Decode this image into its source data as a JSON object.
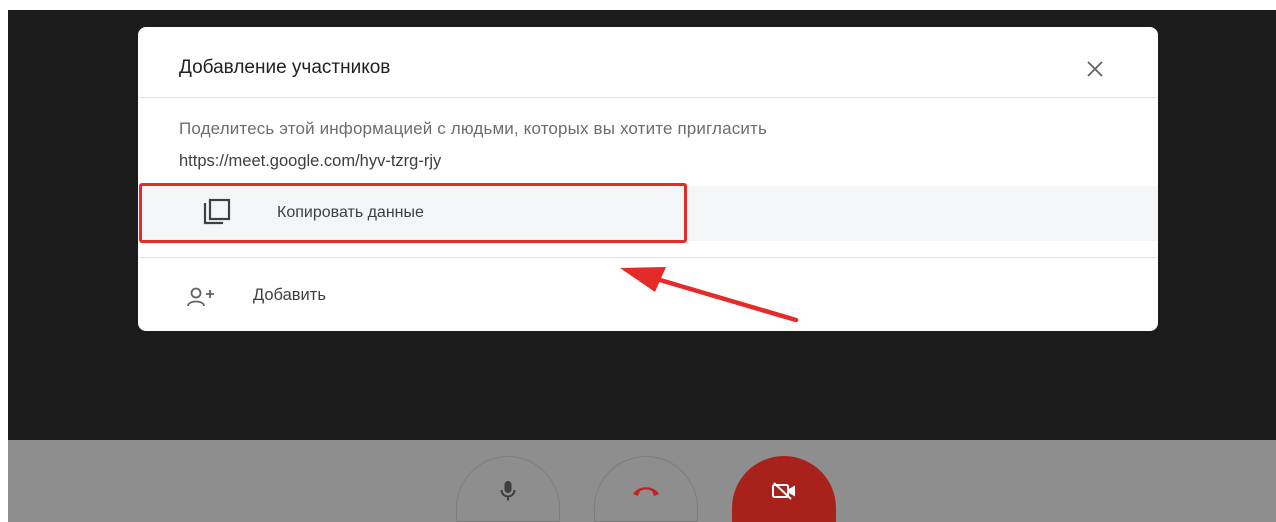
{
  "dialog": {
    "title": "Добавление участников",
    "share_text": "Поделитесь этой информацией с людьми, которых вы хотите пригласить",
    "meeting_link": "https://meet.google.com/hyv-tzrg-rjy",
    "copy_label": "Копировать данные",
    "add_label": "Добавить",
    "close_icon": "close-icon",
    "copy_icon": "copy-icon",
    "add_icon": "person-add-icon"
  },
  "controls": [
    {
      "icon": "microphone-icon"
    },
    {
      "icon": "hang-up-icon"
    },
    {
      "icon": "camera-off-icon"
    }
  ],
  "colors": {
    "annotation_red": "#e52a2a",
    "camera_off_red": "#a8221b",
    "hangup_red": "#c5221f"
  }
}
